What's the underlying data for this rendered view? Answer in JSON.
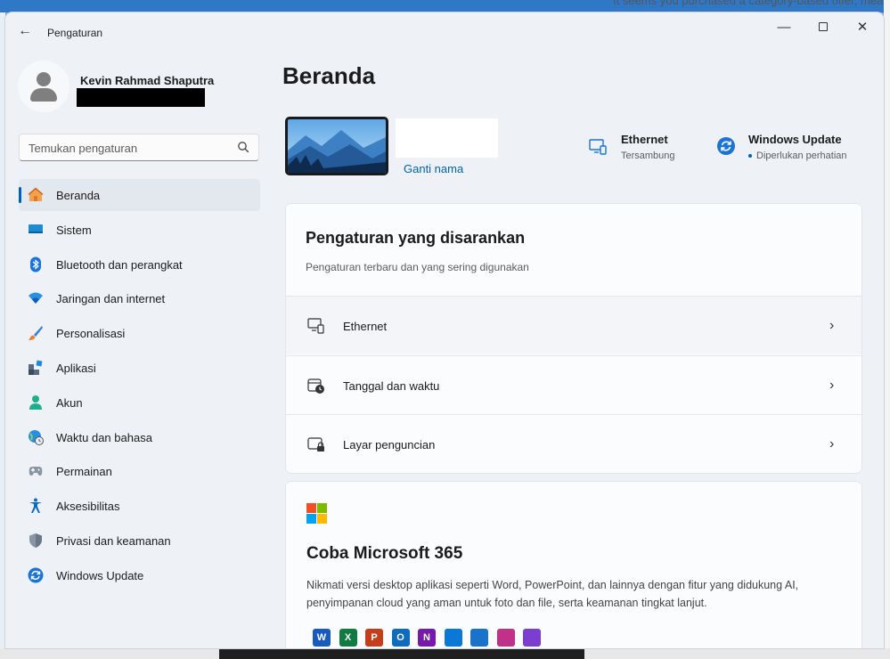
{
  "background": {
    "behind_window_text": "It seems you purchased a category-based offer, mea"
  },
  "window": {
    "title": "Pengaturan",
    "back_glyph": "←",
    "minimize_glyph": "—",
    "close_glyph": "✕"
  },
  "profile": {
    "name": "Kevin Rahmad Shaputra"
  },
  "search": {
    "placeholder": "Temukan pengaturan"
  },
  "sidebar": {
    "items": [
      {
        "label": "Beranda",
        "icon": "home-icon",
        "active": true
      },
      {
        "label": "Sistem",
        "icon": "display-icon"
      },
      {
        "label": "Bluetooth dan perangkat",
        "icon": "bluetooth-icon"
      },
      {
        "label": "Jaringan dan internet",
        "icon": "wifi-icon"
      },
      {
        "label": "Personalisasi",
        "icon": "brush-icon"
      },
      {
        "label": "Aplikasi",
        "icon": "apps-icon"
      },
      {
        "label": "Akun",
        "icon": "account-icon"
      },
      {
        "label": "Waktu dan bahasa",
        "icon": "globe-clock-icon"
      },
      {
        "label": "Permainan",
        "icon": "gamepad-icon"
      },
      {
        "label": "Aksesibilitas",
        "icon": "accessibility-icon"
      },
      {
        "label": "Privasi dan keamanan",
        "icon": "shield-icon"
      },
      {
        "label": "Windows Update",
        "icon": "update-icon"
      }
    ]
  },
  "main": {
    "title": "Beranda",
    "device": {
      "rename_label": "Ganti nama"
    },
    "status": {
      "ethernet": {
        "title": "Ethernet",
        "subtitle": "Tersambung"
      },
      "windows_update": {
        "title": "Windows Update",
        "subtitle": "Diperlukan perhatian"
      }
    },
    "suggested": {
      "title": "Pengaturan yang disarankan",
      "subtitle": "Pengaturan terbaru dan yang sering digunakan",
      "rows": [
        {
          "label": "Ethernet",
          "icon": "ethernet-icon"
        },
        {
          "label": "Tanggal dan waktu",
          "icon": "calendar-clock-icon"
        },
        {
          "label": "Layar penguncian",
          "icon": "lock-screen-icon"
        }
      ],
      "chevron_glyph": "›"
    },
    "m365": {
      "title": "Coba Microsoft 365",
      "description": "Nikmati versi desktop aplikasi seperti Word, PowerPoint, dan lainnya dengan fitur yang didukung AI, penyimpanan cloud yang aman untuk foto dan file, serta keamanan tingkat lanjut.",
      "apps": [
        {
          "name": "word-icon",
          "letter": "W",
          "color": "#185abd"
        },
        {
          "name": "excel-icon",
          "letter": "X",
          "color": "#107c41"
        },
        {
          "name": "powerpoint-icon",
          "letter": "P",
          "color": "#c43e1c"
        },
        {
          "name": "outlook-icon",
          "letter": "O",
          "color": "#0f6cbd"
        },
        {
          "name": "onenote-icon",
          "letter": "N",
          "color": "#7719aa"
        },
        {
          "name": "onedrive-icon",
          "letter": "",
          "color": "#0a78d4"
        },
        {
          "name": "defender-icon",
          "letter": "",
          "color": "#1a73c8"
        },
        {
          "name": "copilot-icon",
          "letter": "",
          "color": "#c0318a"
        },
        {
          "name": "clipchamp-icon",
          "letter": "",
          "color": "#7b3fd0"
        }
      ]
    }
  }
}
